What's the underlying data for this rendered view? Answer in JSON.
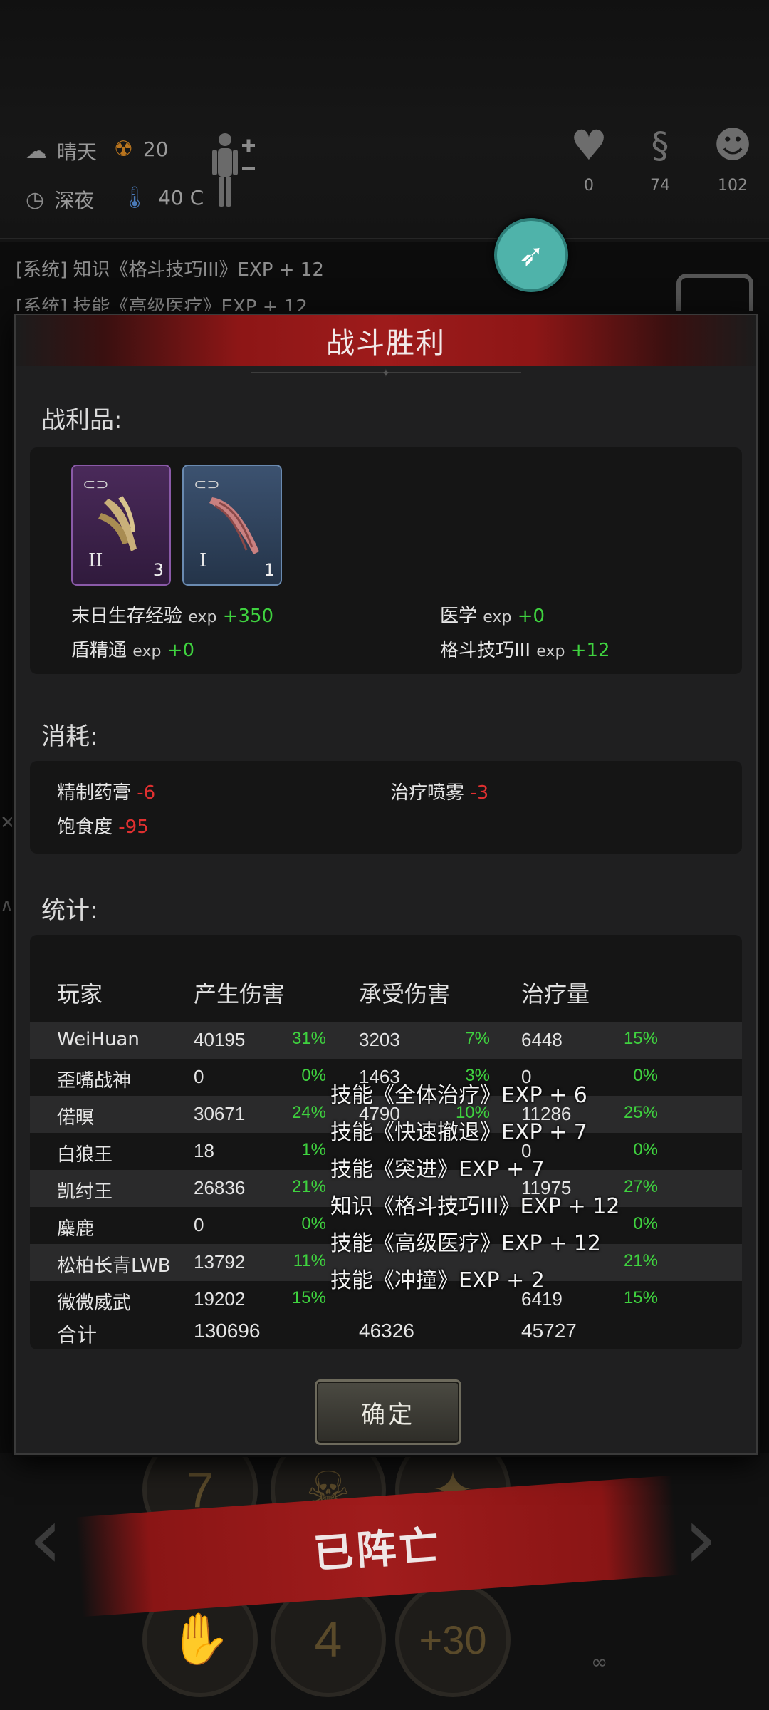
{
  "hud": {
    "weather": "晴天",
    "radiation": "20",
    "time_of_day": "深夜",
    "temperature": "40 C",
    "health": "0",
    "hunger": "74",
    "sanity": "102"
  },
  "background_log": [
    "[系统] 知识《格斗技巧III》EXP + 12",
    "[系统] 技能《高级医疗》EXP + 12"
  ],
  "dialog": {
    "title": "战斗胜利",
    "loot_label": "战利品:",
    "loot_items": [
      {
        "tier": "II",
        "count": "3",
        "color": "#8a5aa8"
      },
      {
        "tier": "I",
        "count": "1",
        "color": "#6a8ab0"
      }
    ],
    "exp_gains": [
      {
        "name": "末日生存经验",
        "unit": "exp",
        "value": "+350"
      },
      {
        "name": "医学",
        "unit": "exp",
        "value": "+0"
      },
      {
        "name": "盾精通",
        "unit": "exp",
        "value": "+0"
      },
      {
        "name": "格斗技巧III",
        "unit": "exp",
        "value": "+12"
      }
    ],
    "consume_label": "消耗:",
    "consumption": [
      {
        "name": "精制药膏",
        "value": "-6"
      },
      {
        "name": "治疗喷雾",
        "value": "-3"
      },
      {
        "name": "饱食度",
        "value": "-95"
      }
    ],
    "stats_label": "统计:",
    "table": {
      "headers": [
        "玩家",
        "产生伤害",
        "承受伤害",
        "治疗量"
      ],
      "rows": [
        {
          "name": "WeiHuan",
          "dmg": "40195",
          "dmg_pct": "31%",
          "taken": "3203",
          "taken_pct": "7%",
          "heal": "6448",
          "heal_pct": "15%"
        },
        {
          "name": "歪嘴战神",
          "dmg": "0",
          "dmg_pct": "0%",
          "taken": "1463",
          "taken_pct": "3%",
          "heal": "0",
          "heal_pct": "0%"
        },
        {
          "name": "偌暝",
          "dmg": "30671",
          "dmg_pct": "24%",
          "taken": "4790",
          "taken_pct": "10%",
          "heal": "11286",
          "heal_pct": "25%"
        },
        {
          "name": "白狼王",
          "dmg": "18",
          "dmg_pct": "1%",
          "taken": "",
          "taken_pct": "",
          "heal": "0",
          "heal_pct": "0%"
        },
        {
          "name": "凯纣王",
          "dmg": "26836",
          "dmg_pct": "21%",
          "taken": "",
          "taken_pct": "",
          "heal": "11975",
          "heal_pct": "27%"
        },
        {
          "name": "麋鹿",
          "dmg": "0",
          "dmg_pct": "0%",
          "taken": "",
          "taken_pct": "",
          "heal": "",
          "heal_pct": "0%"
        },
        {
          "name": "松柏长青LWB",
          "dmg": "13792",
          "dmg_pct": "11%",
          "taken": "",
          "taken_pct": "",
          "heal": "",
          "heal_pct": "21%"
        },
        {
          "name": "微微威武",
          "dmg": "19202",
          "dmg_pct": "15%",
          "taken": "",
          "taken_pct": "",
          "heal": "6419",
          "heal_pct": "15%"
        }
      ],
      "total": {
        "label": "合计",
        "dmg": "130696",
        "taken": "46326",
        "heal": "45727"
      }
    },
    "confirm_label": "确定"
  },
  "floating_log": [
    "技能《全体治疗》EXP + 6",
    "技能《快速撤退》EXP + 7",
    "技能《突进》EXP + 7",
    "知识《格斗技巧III》EXP + 12",
    "技能《高级医疗》EXP + 12",
    "技能《冲撞》EXP + 2"
  ],
  "bottom": {
    "dead_label": "已阵亡",
    "wheel_top_left": "7",
    "wheel_bottom_mid": "4",
    "wheel_bottom_right": "+30",
    "infinity": "∞"
  }
}
